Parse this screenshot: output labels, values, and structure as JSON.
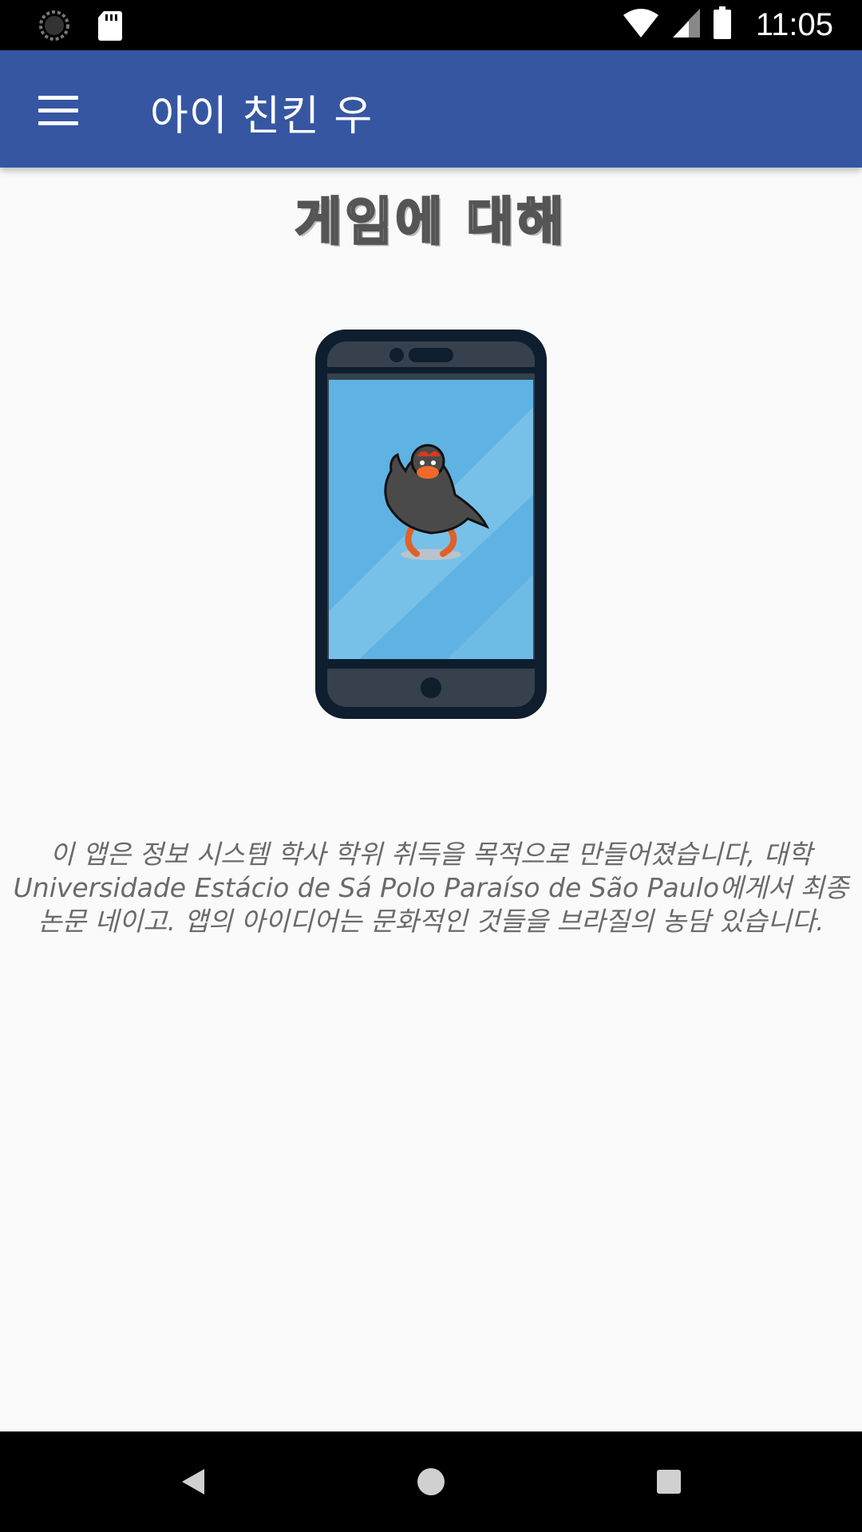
{
  "status_bar": {
    "time": "11:05",
    "icons": [
      "sync-icon",
      "sd-card-icon",
      "wifi-icon",
      "signal-icon",
      "battery-icon"
    ]
  },
  "app_bar": {
    "title": "아이 친킨 우",
    "menu_icon": "hamburger-menu-icon",
    "background_color": "#3656a2"
  },
  "content": {
    "header_logo": "게임에 대해",
    "illustration": "phone-with-bird-character",
    "description": "이 앱은 정보 시스템 학사 학위 취득을 목적으로 만들어졌습니다, 대학 Universidade Estácio de Sá Polo Paraíso de São Paulo에게서 최종 논문 네이고. 앱의 아이디어는 문화적인 것들을 브라질의 농담 있습니다."
  },
  "nav_bar": {
    "back_icon": "back-triangle-icon",
    "home_icon": "home-circle-icon",
    "recents_icon": "recents-square-icon"
  }
}
